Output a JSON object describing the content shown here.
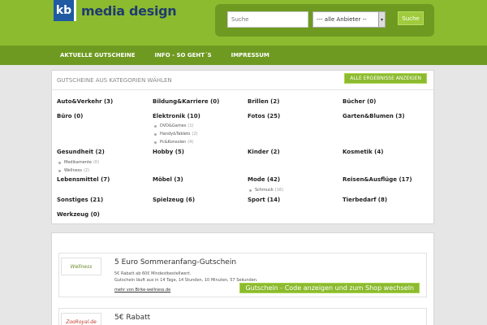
{
  "header": {
    "logo_badge": "kb",
    "logo_text": "media design",
    "search_placeholder": "Suche",
    "provider_select": "--- alle Anbieter --",
    "search_button": "Suche",
    "brand_color": "#8cbb2f"
  },
  "nav": {
    "items": [
      "AKTUELLE GUTSCHEINE",
      "INFO - SO GEHT´S",
      "IMPRESSUM"
    ]
  },
  "categories_panel": {
    "title": "GUTSCHEINE AUS KATEGORIEN WÄHLEN",
    "show_all_button": "ALLE ERGEBNISSE ANZEIGEN",
    "categories": [
      "Auto&Verkehr (3)",
      "Bildung&Karriere (0)",
      "Brillen (2)",
      "Bücher (0)",
      "Büro (0)",
      "Elektronik (10)",
      "Fotos (25)",
      "Garten&Blumen (3)",
      "Gesundheit (2)",
      "Hobby (5)",
      "Kinder (2)",
      "Kosmetik (4)",
      "Lebensmittel (7)",
      "Möbel (3)",
      "Mode (42)",
      "Reisen&Ausflüge (17)",
      "Sonstiges (21)",
      "Spielzeug (6)",
      "Sport (14)",
      "Tierbedarf (8)",
      "Werkzeug (0)"
    ],
    "subcategories": {
      "elektronik": [
        {
          "name": "DVD&Games",
          "count": "(1)"
        },
        {
          "name": "Handy&Tablets",
          "count": "(2)"
        },
        {
          "name": "Pc&Konsolen",
          "count": "(4)"
        }
      ],
      "gesundheit": [
        {
          "name": "Medikamente",
          "count": "(0)"
        },
        {
          "name": "Wellness",
          "count": "(2)"
        }
      ],
      "mode": [
        {
          "name": "Schmuck",
          "count": "(16)"
        }
      ]
    }
  },
  "coupons": [
    {
      "logo": "Wellness",
      "title": "5 Euro Sommeranfang-Gutschein",
      "desc_line1": "5€ Rabatt ab 60€ Mindestbestellwert.",
      "desc_line2": "Gutschein läuft aus in 14 Tage, 14 Stunden, 10 Minuten, 57 Sekunden.",
      "more_link": "mehr von Birke-wellness.de",
      "cta": "Gutschein - Code anzeigen und zum Shop wechseln"
    },
    {
      "logo": "ZooRoyal.de",
      "title": "5€ Rabatt"
    }
  ]
}
